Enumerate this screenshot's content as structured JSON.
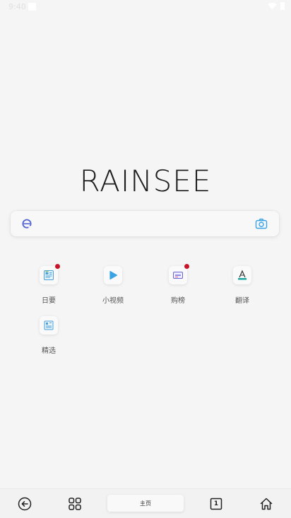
{
  "status_bar": {
    "time": "9:40"
  },
  "brand": {
    "logo_text": "RAINSEE"
  },
  "search": {
    "value": "",
    "placeholder": ""
  },
  "shortcuts": [
    {
      "label": "日要",
      "icon": "news-icon",
      "badge": true
    },
    {
      "label": "小视频",
      "icon": "play-icon",
      "badge": false
    },
    {
      "label": "购榜",
      "icon": "shopping-icon",
      "badge": true
    },
    {
      "label": "翻译",
      "icon": "translate-icon",
      "badge": false
    },
    {
      "label": "精选",
      "icon": "picks-icon",
      "badge": false
    }
  ],
  "bottom_bar": {
    "home_label": "主页",
    "tab_count": "1"
  },
  "colors": {
    "badge": "#c81428",
    "accent_blue": "#3aa3e3",
    "background": "#f5f5f5"
  }
}
